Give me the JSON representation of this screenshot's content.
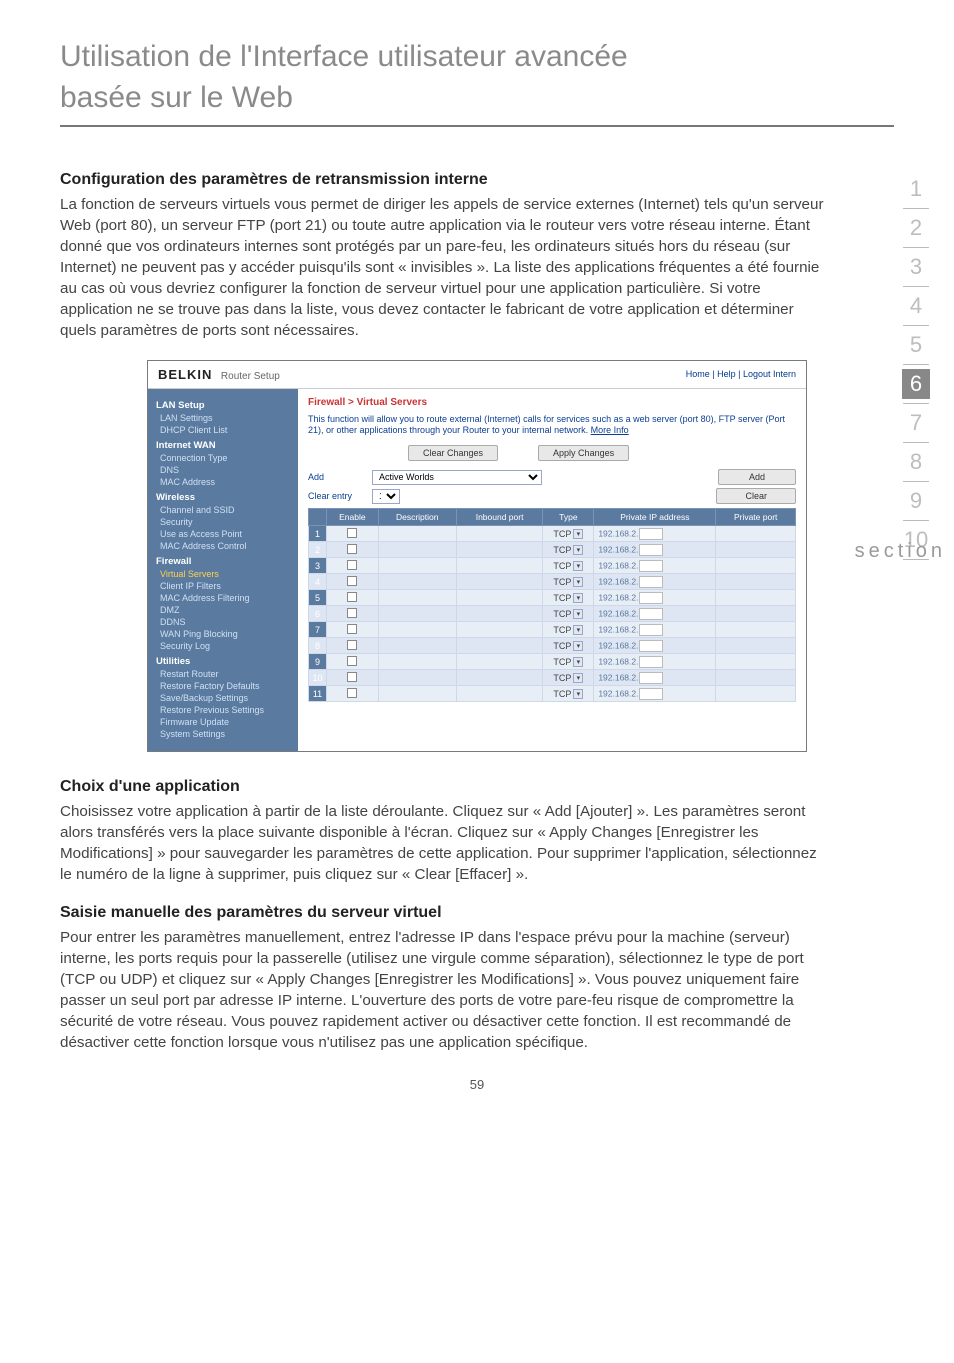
{
  "page_title_line1": "Utilisation de l'Interface utilisateur avancée",
  "page_title_line2": "basée sur le Web",
  "nav": {
    "items": [
      "1",
      "2",
      "3",
      "4",
      "5",
      "6",
      "7",
      "8",
      "9",
      "10"
    ],
    "active": "6",
    "label": "section"
  },
  "sec1": {
    "heading": "Configuration des paramètres de retransmission interne",
    "body": "La fonction de serveurs virtuels vous permet de diriger les appels de service externes (Internet) tels qu'un serveur Web (port 80), un serveur FTP (port 21) ou toute autre application via le routeur vers votre réseau interne. Étant donné que vos ordinateurs internes sont protégés par un pare-feu, les ordinateurs situés hors du réseau (sur Internet) ne peuvent pas y accéder puisqu'ils sont « invisibles ». La liste des applications fréquentes a été fournie au cas où vous devriez configurer la fonction de serveur virtuel pour une application particulière. Si votre application ne se trouve pas dans la liste, vous devez contacter le fabricant de votre application et déterminer quels paramètres de ports sont nécessaires."
  },
  "screenshot": {
    "logo": "BELKIN",
    "router_setup": "Router Setup",
    "top_links": "Home | Help | Logout    Intern",
    "breadcrumb": "Firewall > Virtual Servers",
    "desc": "This function will allow you to route external (Internet) calls for services such as a web server (port 80), FTP server (Port 21), or other applications through your Router to your internal network.",
    "more": "More Info",
    "btn_clear_changes": "Clear Changes",
    "btn_apply_changes": "Apply Changes",
    "add_label": "Add",
    "add_value": "Active Worlds",
    "add_btn": "Add",
    "clear_label": "Clear entry",
    "clear_value": "1",
    "clear_btn": "Clear",
    "headers": [
      "",
      "Enable",
      "Description",
      "Inbound port",
      "Type",
      "Private IP address",
      "Private port"
    ],
    "type_val": "TCP",
    "ip_prefix": "192.168.2.",
    "rows": 11,
    "sidebar": {
      "cats": [
        {
          "title": "LAN Setup",
          "items": [
            "LAN Settings",
            "DHCP Client List"
          ]
        },
        {
          "title": "Internet WAN",
          "items": [
            "Connection Type",
            "DNS",
            "MAC Address"
          ]
        },
        {
          "title": "Wireless",
          "items": [
            "Channel and SSID",
            "Security",
            "Use as Access Point",
            "MAC Address Control"
          ]
        },
        {
          "title": "Firewall",
          "items_hl_first": true,
          "items": [
            "Virtual Servers",
            "Client IP Filters",
            "MAC Address Filtering",
            "DMZ",
            "DDNS",
            "WAN Ping Blocking",
            "Security Log"
          ]
        },
        {
          "title": "Utilities",
          "items": [
            "Restart Router",
            "Restore Factory Defaults",
            "Save/Backup Settings",
            "Restore Previous Settings",
            "Firmware Update",
            "System Settings"
          ]
        }
      ]
    }
  },
  "sec2": {
    "heading": "Choix d'une application",
    "body": "Choisissez votre application à partir de la liste déroulante. Cliquez sur « Add [Ajouter] ». Les paramètres seront alors transférés vers la place suivante disponible à l'écran. Cliquez sur « Apply Changes [Enregistrer les Modifications] » pour sauvegarder les paramètres de cette application. Pour supprimer l'application, sélectionnez le numéro de la ligne à supprimer, puis cliquez sur « Clear [Effacer] »."
  },
  "sec3": {
    "heading": "Saisie manuelle des paramètres du serveur virtuel",
    "body": "Pour entrer les paramètres manuellement, entrez l'adresse IP dans l'espace prévu pour la machine (serveur) interne, les ports requis pour la passerelle (utilisez une virgule comme séparation), sélectionnez le type de port (TCP ou UDP) et cliquez sur « Apply Changes [Enregistrer les Modifications] ». Vous pouvez uniquement faire passer un seul port par adresse IP interne. L'ouverture des ports de votre pare-feu risque de compromettre la sécurité de votre réseau. Vous pouvez rapidement activer ou désactiver cette fonction. Il est recommandé de désactiver cette fonction lorsque vous n'utilisez pas une application spécifique."
  },
  "page_number": "59"
}
